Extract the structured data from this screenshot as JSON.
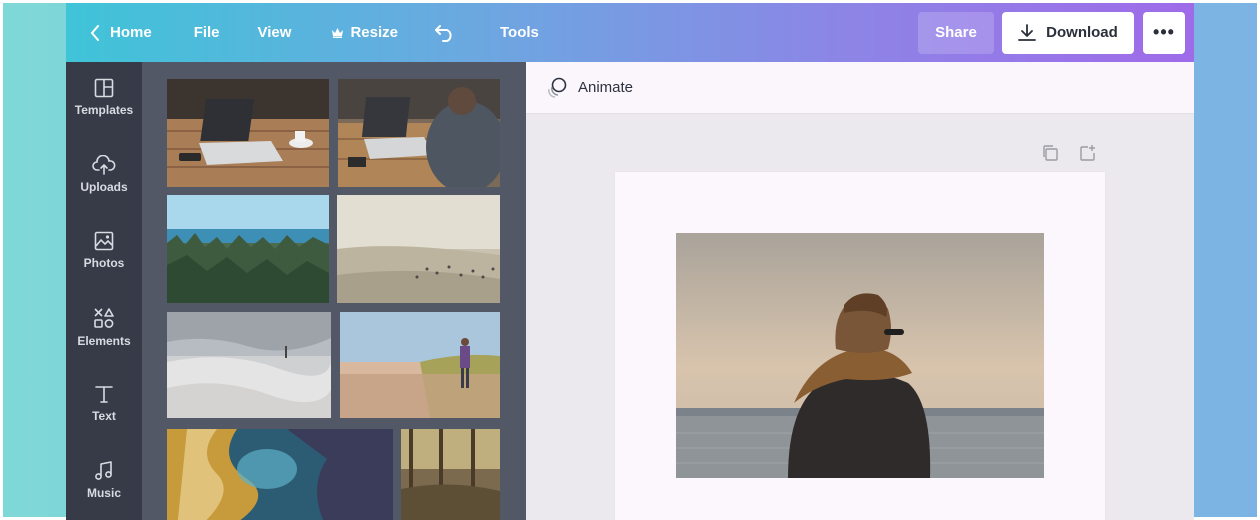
{
  "topbar": {
    "home_label": "Home",
    "file_label": "File",
    "view_label": "View",
    "resize_label": "Resize",
    "tools_label": "Tools",
    "share_label": "Share",
    "download_label": "Download",
    "more_label": "•••"
  },
  "leftnav": {
    "items": [
      {
        "label": "Templates",
        "icon": "templates-icon"
      },
      {
        "label": "Uploads",
        "icon": "upload-cloud-icon"
      },
      {
        "label": "Photos",
        "icon": "photo-icon"
      },
      {
        "label": "Elements",
        "icon": "elements-icon"
      },
      {
        "label": "Text",
        "icon": "text-icon"
      },
      {
        "label": "Music",
        "icon": "music-icon"
      }
    ]
  },
  "toolbar": {
    "animate_label": "Animate"
  },
  "colors": {
    "sidebar_bg": "#363b47",
    "panel_bg": "#525866",
    "topbar_start": "#3fc4d8",
    "topbar_end": "#9f6be9"
  }
}
